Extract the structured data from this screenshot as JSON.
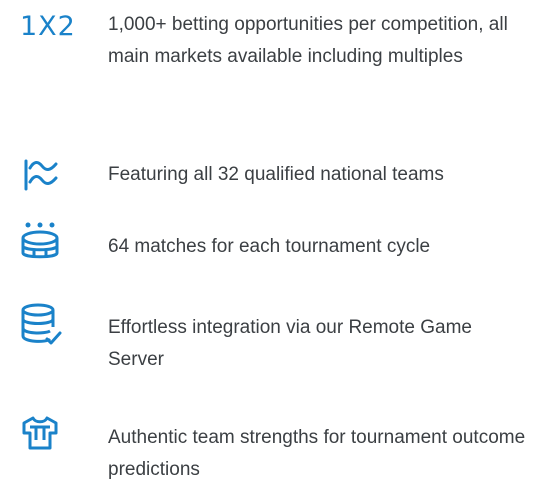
{
  "features": [
    {
      "icon": "odds-1x2-icon",
      "icon_text": "1X2",
      "text": "1,000+ betting opportunities per competition, all main markets available including multiples"
    },
    {
      "icon": "wave-chart-icon",
      "text": "Featuring all 32 qualified national teams"
    },
    {
      "icon": "stadium-icon",
      "text": "64 matches for each tournament cycle"
    },
    {
      "icon": "database-check-icon",
      "text": "Effortless integration via our Remote Game Server"
    },
    {
      "icon": "jersey-icon",
      "text": "Authentic team strengths for tournament outcome predictions"
    }
  ],
  "colors": {
    "accent": "#1a82c9",
    "text": "#3b3f43",
    "background": "#ffffff"
  }
}
